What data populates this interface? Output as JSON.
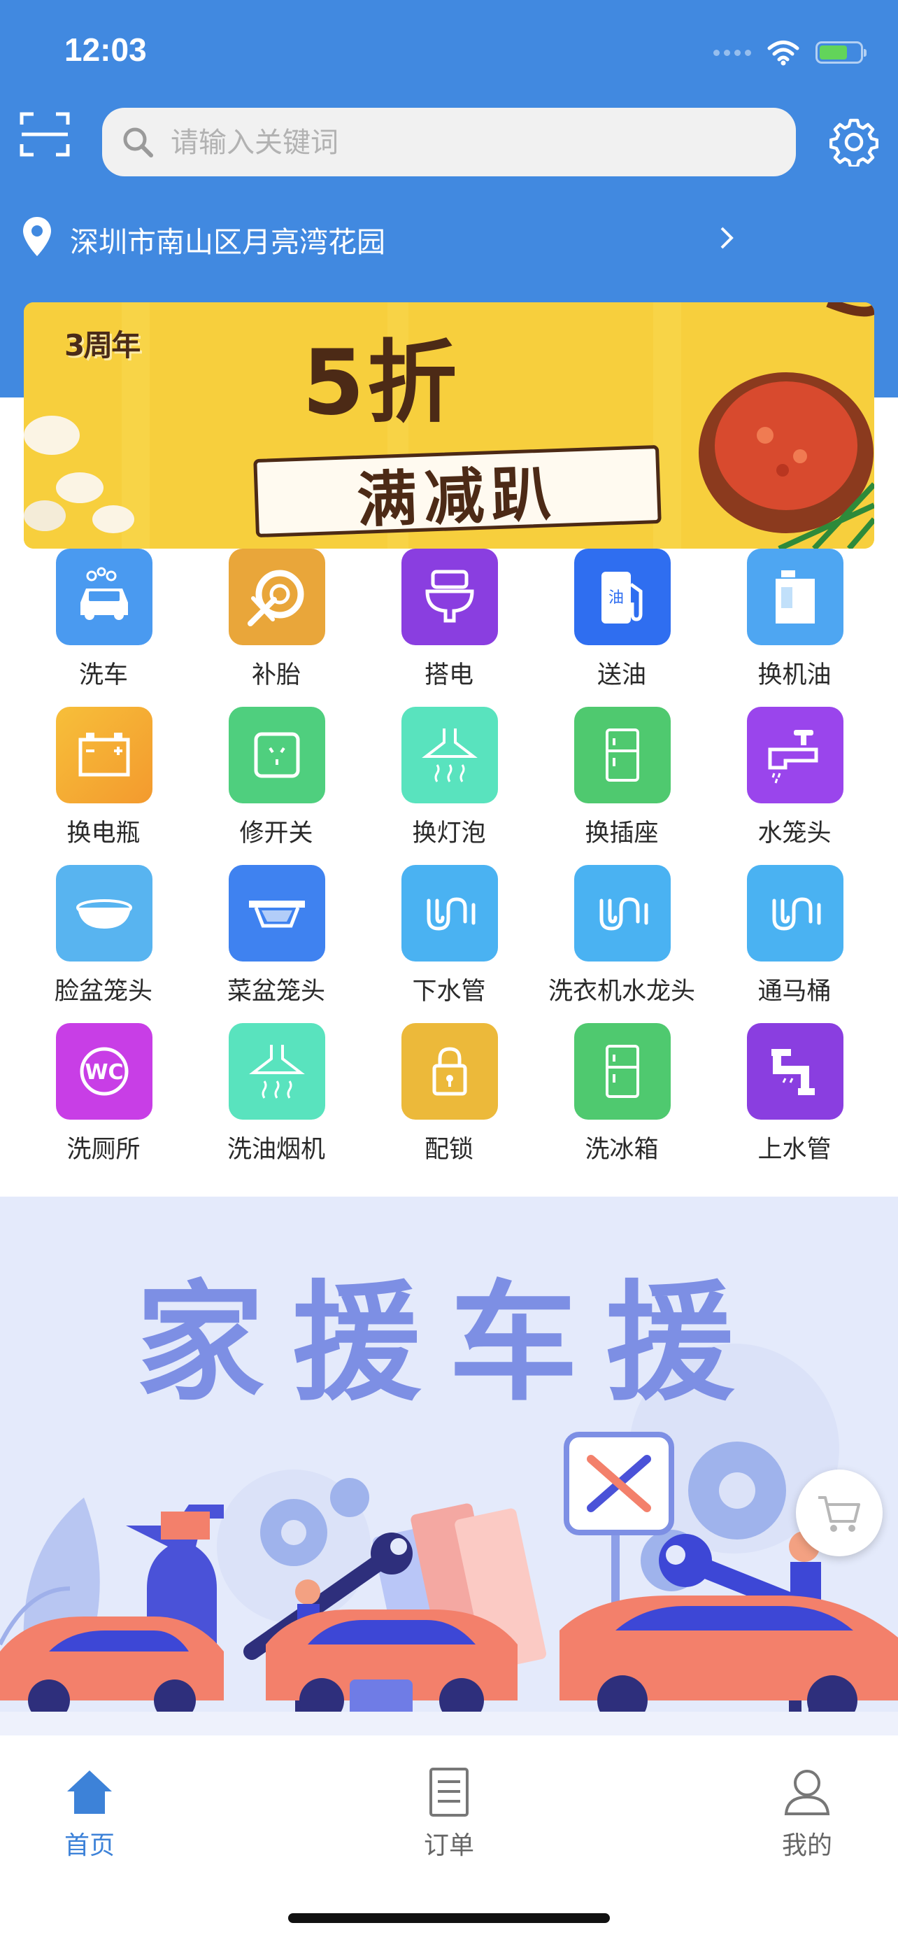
{
  "status_bar": {
    "time": "12:03"
  },
  "header": {
    "search_placeholder": "请输入关键词",
    "location": "深圳市南山区月亮湾花园"
  },
  "banner": {
    "badge": "3周年",
    "headline": "5折",
    "subline": "满减趴"
  },
  "services": [
    {
      "label": "洗车",
      "icon": "car-wash-icon",
      "color": "#4a9af0"
    },
    {
      "label": "补胎",
      "icon": "tire-repair-icon",
      "color": "#e9a63a"
    },
    {
      "label": "搭电",
      "icon": "toilet-icon",
      "color": "#8a3ee0"
    },
    {
      "label": "送油",
      "icon": "fuel-pump-icon",
      "color": "#2f6ef0"
    },
    {
      "label": "换机油",
      "icon": "oil-can-icon",
      "color": "#4ea6f2"
    },
    {
      "label": "换电瓶",
      "icon": "battery-icon",
      "color": "#f6b136"
    },
    {
      "label": "修开关",
      "icon": "socket-icon",
      "color": "#4fcf7e"
    },
    {
      "label": "换灯泡",
      "icon": "range-hood-icon",
      "color": "#59e3be"
    },
    {
      "label": "换插座",
      "icon": "fridge-icon",
      "color": "#4fc96f"
    },
    {
      "label": "水笼头",
      "icon": "faucet-icon",
      "color": "#9a45ec"
    },
    {
      "label": "脸盆笼头",
      "icon": "basin-icon",
      "color": "#58b4f0"
    },
    {
      "label": "菜盆笼头",
      "icon": "sink-icon",
      "color": "#3f82f0"
    },
    {
      "label": "下水管",
      "icon": "drain-pipe-icon",
      "color": "#4ab2f2"
    },
    {
      "label": "洗衣机水龙头",
      "icon": "drain-pipe-icon",
      "color": "#4ab2f2"
    },
    {
      "label": "通马桶",
      "icon": "drain-pipe-icon",
      "color": "#4ab2f2"
    },
    {
      "label": "洗厕所",
      "icon": "wc-icon",
      "color": "#c83ee6"
    },
    {
      "label": "洗油烟机",
      "icon": "range-hood-icon",
      "color": "#59e3be"
    },
    {
      "label": "配锁",
      "icon": "lock-icon",
      "color": "#ecb93a"
    },
    {
      "label": "洗冰箱",
      "icon": "fridge-icon",
      "color": "#4fc96f"
    },
    {
      "label": "上水管",
      "icon": "water-pipe-icon",
      "color": "#8a3ee0"
    }
  ],
  "promo": {
    "title": "家援车援"
  },
  "tabs": [
    {
      "label": "首页",
      "icon": "home-icon",
      "active": true
    },
    {
      "label": "订单",
      "icon": "order-list-icon",
      "active": false
    },
    {
      "label": "我的",
      "icon": "user-icon",
      "active": false
    }
  ],
  "colors": {
    "header_blue": "#4189e0",
    "tab_active": "#3d82d8",
    "promo_bg": "#e4eafb",
    "promo_title": "#7d8fe4"
  }
}
